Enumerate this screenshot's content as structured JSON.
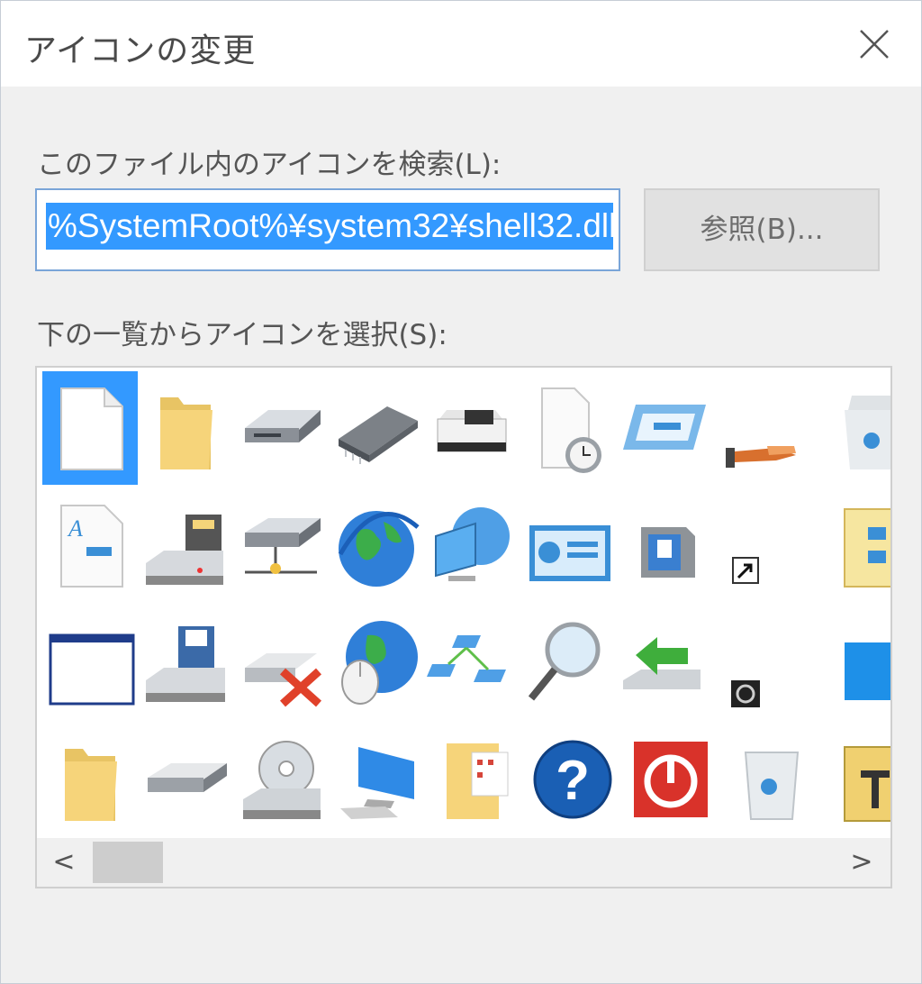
{
  "dialog": {
    "title": "アイコンの変更",
    "close_icon": "close-icon"
  },
  "file_section": {
    "label": "このファイル内のアイコンを検索(L):",
    "path_value": "%SystemRoot%¥system32¥shell32.dll",
    "browse_label": "参照(B)..."
  },
  "icon_section": {
    "label": "下の一覧からアイコンを選択(S):",
    "columns": [
      [
        "blank-document-icon",
        "application-text-icon"
      ],
      [
        "folder-icon",
        "floppy-drive-icon"
      ],
      [
        "hard-drive-icon",
        "network-drive-icon"
      ],
      [
        "memory-chip-icon",
        "globe-ie-icon"
      ],
      [
        "printer-icon",
        "network-computer-icon"
      ],
      [
        "scheduled-file-icon",
        "control-panel-display-icon"
      ],
      [
        "card-reader-icon",
        "floppy-media-icon"
      ],
      [
        "hand-drive-icon",
        "shortcut-arrow-icon"
      ],
      [
        "recycle-bin-full-icon",
        "folder-share-icon"
      ]
    ],
    "rows_3_4": [
      [
        "application-window-icon",
        "folder-icon"
      ],
      [
        "floppy-save-icon",
        "removable-drive-icon"
      ],
      [
        "drive-error-icon",
        "cd-drive-icon"
      ],
      [
        "globe-mouse-icon",
        "monitor-icon"
      ],
      [
        "network-nodes-icon",
        "folder-documents-icon"
      ],
      [
        "search-magnifier-icon",
        "help-icon"
      ],
      [
        "log-off-arrow-icon",
        "shutdown-icon"
      ],
      [
        "smart-card-icon",
        "recycle-bin-empty-icon"
      ],
      [
        "blue-square-icon",
        "folder-tools-icon"
      ]
    ],
    "selected_index": 0
  },
  "scrollbar": {
    "left_arrow": "<",
    "right_arrow": ">"
  },
  "colors": {
    "selection": "#3399ff",
    "background": "#f0f0f0"
  }
}
